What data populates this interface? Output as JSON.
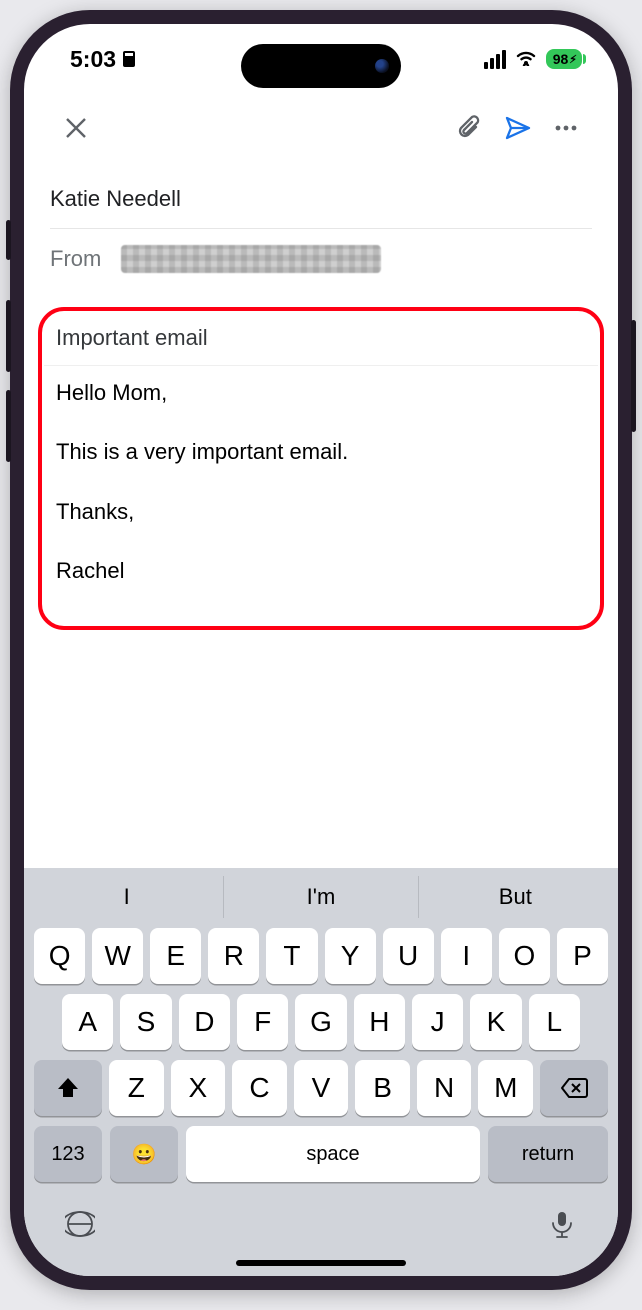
{
  "status": {
    "time": "5:03",
    "battery": "98"
  },
  "compose": {
    "to": "Katie Needell",
    "from_label": "From",
    "subject": "Important email",
    "body": "Hello Mom,\n\nThis is a very important email.\n\nThanks,\n\nRachel"
  },
  "keyboard": {
    "suggestions": [
      "I",
      "I'm",
      "But"
    ],
    "row1": [
      "Q",
      "W",
      "E",
      "R",
      "T",
      "Y",
      "U",
      "I",
      "O",
      "P"
    ],
    "row2": [
      "A",
      "S",
      "D",
      "F",
      "G",
      "H",
      "J",
      "K",
      "L"
    ],
    "row3": [
      "Z",
      "X",
      "C",
      "V",
      "B",
      "N",
      "M"
    ],
    "numKey": "123",
    "space": "space",
    "return": "return",
    "emoji": "😀"
  }
}
